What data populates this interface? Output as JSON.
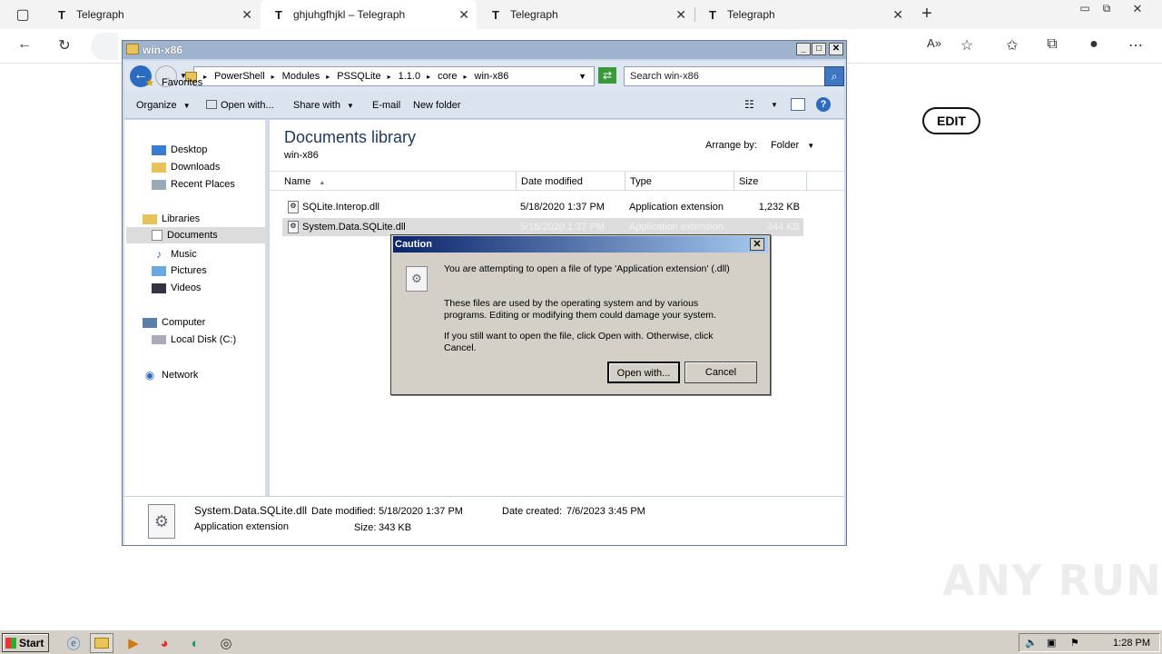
{
  "browser": {
    "tabs": [
      {
        "title": "Telegraph",
        "logo": "T"
      },
      {
        "title": "ghjuhgfhjkl – Telegraph",
        "logo": "T"
      },
      {
        "title": "Telegraph",
        "logo": "T"
      },
      {
        "title": "Telegraph",
        "logo": "T"
      }
    ],
    "edit_label": "EDIT"
  },
  "explorer": {
    "title": "win-x86",
    "breadcrumb": [
      "PowerShell",
      "Modules",
      "PSSQLite",
      "1.1.0",
      "core",
      "win-x86"
    ],
    "search_placeholder": "Search win-x86",
    "toolbar": {
      "organize": "Organize",
      "open_with": "Open with...",
      "share_with": "Share with",
      "email": "E-mail",
      "new_folder": "New folder"
    },
    "nav": {
      "favorites": "Favorites",
      "desktop": "Desktop",
      "downloads": "Downloads",
      "recent": "Recent Places",
      "libraries": "Libraries",
      "documents": "Documents",
      "music": "Music",
      "pictures": "Pictures",
      "videos": "Videos",
      "computer": "Computer",
      "local_disk": "Local Disk (C:)",
      "network": "Network"
    },
    "library_title": "Documents library",
    "library_subtitle": "win-x86",
    "arrange_by_label": "Arrange by:",
    "arrange_by_value": "Folder",
    "columns": {
      "name": "Name",
      "date": "Date modified",
      "type": "Type",
      "size": "Size"
    },
    "files": [
      {
        "name": "SQLite.Interop.dll",
        "date": "5/18/2020 1:37 PM",
        "type": "Application extension",
        "size": "1,232 KB"
      },
      {
        "name": "System.Data.SQLite.dll",
        "date": "5/18/2020 1:37 PM",
        "type": "Application extension",
        "size": "344 KB"
      }
    ],
    "details": {
      "name": "System.Data.SQLite.dll",
      "type": "Application extension",
      "date_modified_label": "Date modified:",
      "date_modified": "5/18/2020 1:37 PM",
      "size_label": "Size:",
      "size": "343 KB",
      "date_created_label": "Date created:",
      "date_created": "7/6/2023 3:45 PM"
    }
  },
  "dialog": {
    "title": "Caution",
    "line1": "You are attempting to open a file of type 'Application extension' (.dll)",
    "line2": "These files are used by the operating system and by various programs. Editing or modifying them could damage your system.",
    "line3": "If you still want to open the file, click Open with. Otherwise, click Cancel.",
    "open_with": "Open with...",
    "cancel": "Cancel"
  },
  "taskbar": {
    "start": "Start",
    "clock": "1:28 PM"
  },
  "watermark": "ANY RUN"
}
